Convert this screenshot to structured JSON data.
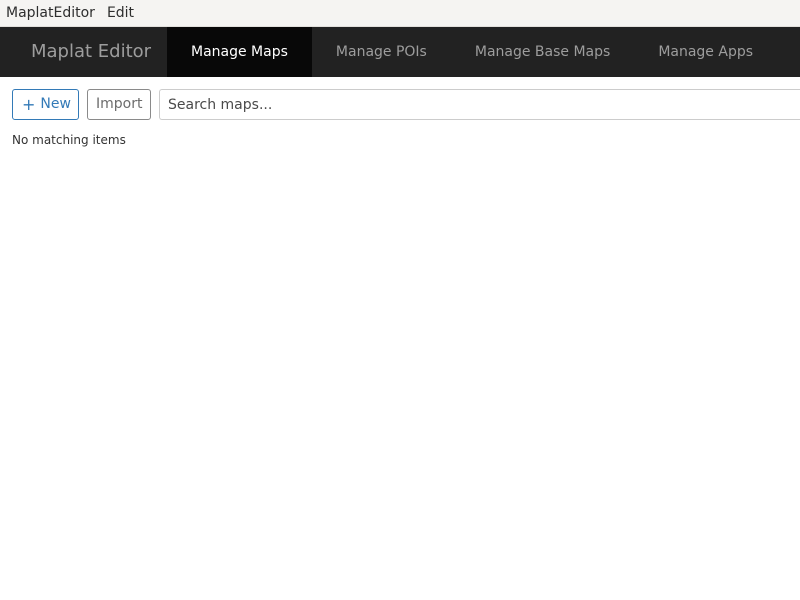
{
  "menubar": {
    "items": [
      {
        "label": "MaplatEditor"
      },
      {
        "label": "Edit"
      }
    ]
  },
  "navbar": {
    "brand": "Maplat Editor",
    "tabs": [
      {
        "label": "Manage Maps",
        "active": true
      },
      {
        "label": "Manage POIs",
        "active": false
      },
      {
        "label": "Manage Base Maps",
        "active": false
      },
      {
        "label": "Manage Apps",
        "active": false
      }
    ]
  },
  "toolbar": {
    "new_icon": "plus-icon",
    "new_label": "New",
    "import_label": "Import",
    "search_placeholder": "Search maps...",
    "search_value": ""
  },
  "list": {
    "empty_message": "No matching items"
  },
  "colors": {
    "navbar_bg": "#222222",
    "active_tab_bg": "#080808",
    "primary": "#337ab7"
  }
}
